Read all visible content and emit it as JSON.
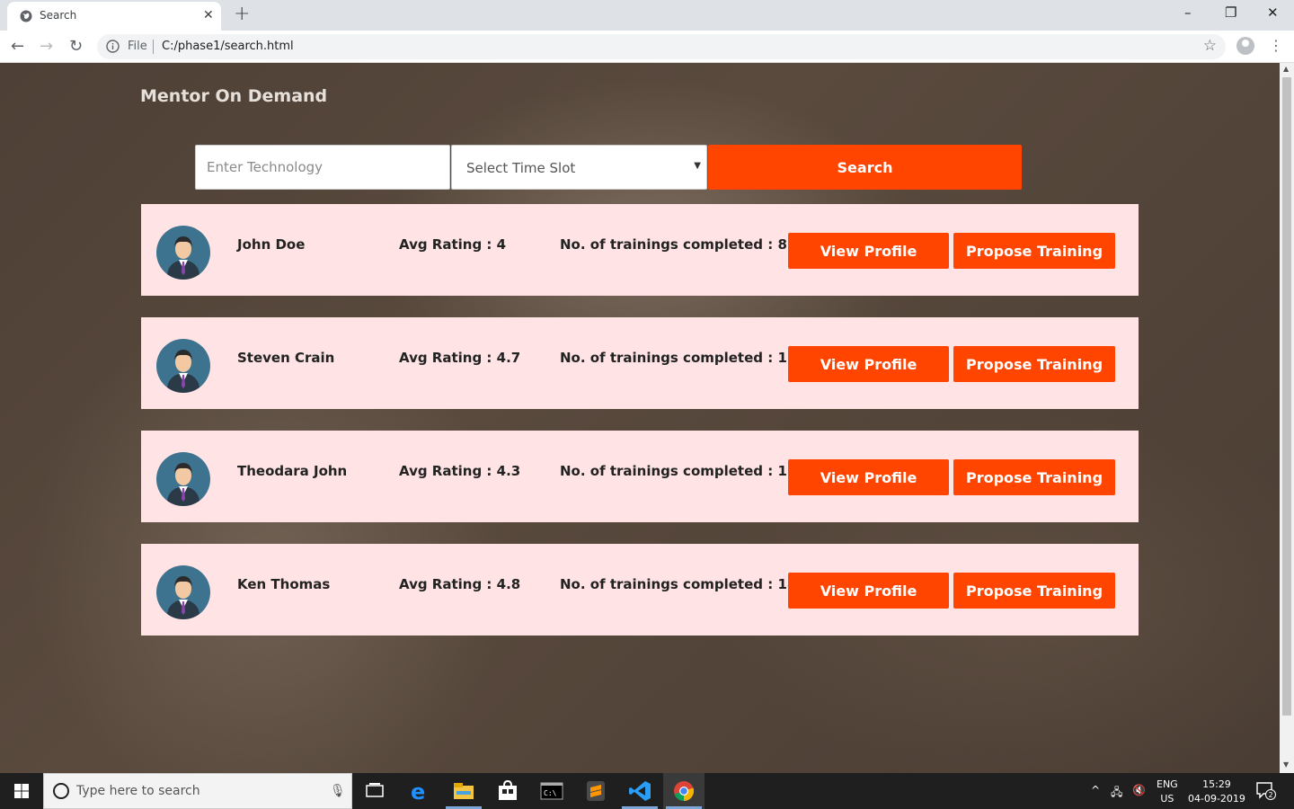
{
  "browser": {
    "tab_title": "Search",
    "tab_close": "✕",
    "new_tab": "+",
    "address_prefix": "File",
    "url": "C:/phase1/search.html",
    "win_minimize": "–",
    "win_restore": "❐",
    "win_close": "✕"
  },
  "app": {
    "brand": "Mentor On Demand"
  },
  "search": {
    "technology_placeholder": "Enter Technology",
    "time_slot_value": "Select Time Slot",
    "button_label": "Search"
  },
  "mentors": [
    {
      "name": "John Doe",
      "rating": "Avg Rating : 4",
      "trainings": "No. of trainings completed : 8",
      "view_label": "View Profile",
      "propose_label": "Propose Training"
    },
    {
      "name": "Steven Crain",
      "rating": "Avg Rating : 4.7",
      "trainings": "No. of trainings completed : 15",
      "view_label": "View Profile",
      "propose_label": "Propose Training"
    },
    {
      "name": "Theodara John",
      "rating": "Avg Rating : 4.3",
      "trainings": "No. of trainings completed : 11",
      "view_label": "View Profile",
      "propose_label": "Propose Training"
    },
    {
      "name": "Ken Thomas",
      "rating": "Avg Rating : 4.8",
      "trainings": "No. of trainings completed : 18",
      "view_label": "View Profile",
      "propose_label": "Propose Training"
    }
  ],
  "taskbar": {
    "search_placeholder": "Type here to search",
    "lang_1": "ENG",
    "lang_2": "US",
    "time": "15:29",
    "date": "04-09-2019",
    "notification_count": "2"
  },
  "colors": {
    "accent": "#ff4500",
    "card_bg": "#ffe3e5"
  }
}
